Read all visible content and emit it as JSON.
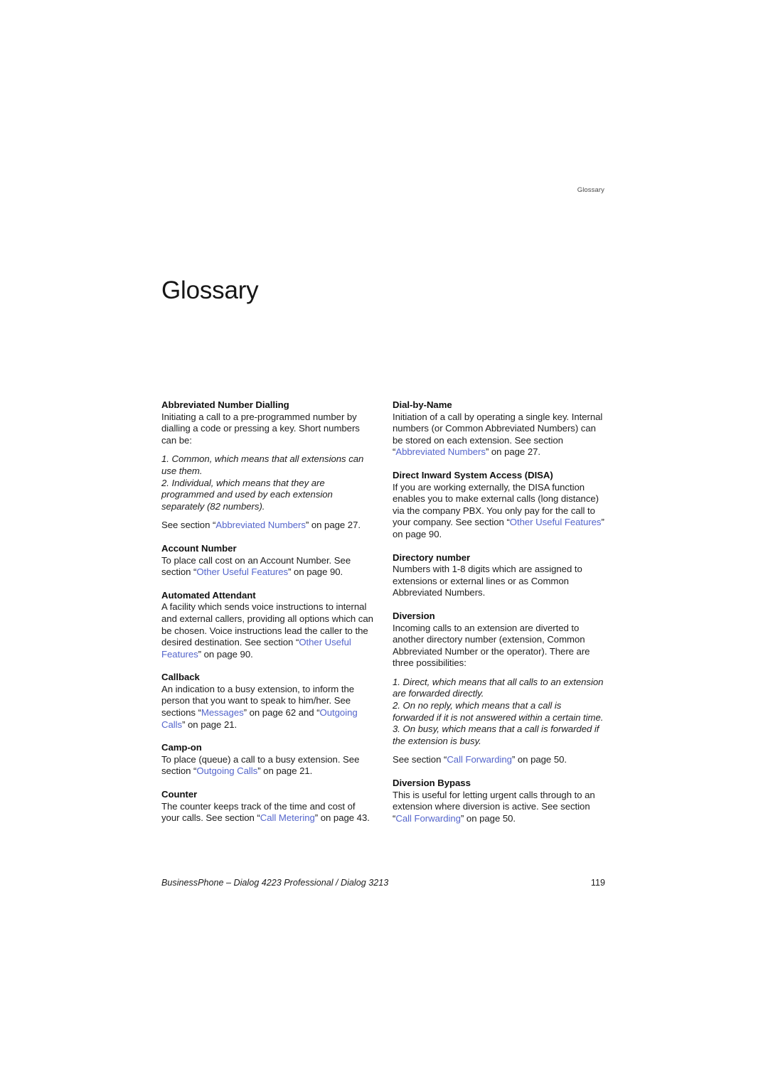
{
  "header": {
    "running_head": "Glossary"
  },
  "title": "Glossary",
  "link_color": "#5566cc",
  "left_column": {
    "entries": [
      {
        "term": "Abbreviated Number Dialling",
        "blocks": [
          {
            "style": "plain",
            "parts": [
              {
                "t": "text",
                "v": "Initiating a call to a pre-programmed number by dialling a code or pressing a key. Short numbers can be:"
              }
            ]
          },
          {
            "style": "italic-gap",
            "parts": [
              {
                "t": "text",
                "v": "1. Common, which means that all extensions can use them."
              }
            ]
          },
          {
            "style": "italic",
            "parts": [
              {
                "t": "text",
                "v": "2. Individual, which means that they are programmed and used by each extension separately (82 numbers)."
              }
            ]
          },
          {
            "style": "plain-gap",
            "parts": [
              {
                "t": "text",
                "v": "See section “"
              },
              {
                "t": "link",
                "v": "Abbreviated Numbers"
              },
              {
                "t": "text",
                "v": "” on page 27."
              }
            ]
          }
        ]
      },
      {
        "term": "Account Number",
        "blocks": [
          {
            "style": "plain",
            "parts": [
              {
                "t": "text",
                "v": "To place call cost on an Account Number. See section “"
              },
              {
                "t": "link",
                "v": "Other Useful Features"
              },
              {
                "t": "text",
                "v": "” on page 90."
              }
            ]
          }
        ]
      },
      {
        "term": "Automated Attendant",
        "blocks": [
          {
            "style": "plain",
            "parts": [
              {
                "t": "text",
                "v": "A facility which sends voice instructions to internal and external callers, providing all options which can be chosen. Voice instructions lead the caller to the desired destination. See section “"
              },
              {
                "t": "link",
                "v": "Other Useful Features"
              },
              {
                "t": "text",
                "v": "” on page 90."
              }
            ]
          }
        ]
      },
      {
        "term": "Callback",
        "blocks": [
          {
            "style": "plain",
            "parts": [
              {
                "t": "text",
                "v": "An indication to a busy extension, to inform the person that you want to speak to him/her. See sections “"
              },
              {
                "t": "link",
                "v": "Messages"
              },
              {
                "t": "text",
                "v": "” on page 62 and “"
              },
              {
                "t": "link",
                "v": "Outgoing Calls"
              },
              {
                "t": "text",
                "v": "” on page 21."
              }
            ]
          }
        ]
      },
      {
        "term": "Camp-on",
        "blocks": [
          {
            "style": "plain",
            "parts": [
              {
                "t": "text",
                "v": "To place (queue) a call to a busy extension. See section “"
              },
              {
                "t": "link",
                "v": "Outgoing Calls"
              },
              {
                "t": "text",
                "v": "” on page 21."
              }
            ]
          }
        ]
      },
      {
        "term": "Counter",
        "blocks": [
          {
            "style": "plain",
            "parts": [
              {
                "t": "text",
                "v": "The counter keeps track of the time and cost of your calls. See section “"
              },
              {
                "t": "link",
                "v": "Call Metering"
              },
              {
                "t": "text",
                "v": "” on page 43."
              }
            ]
          }
        ]
      }
    ]
  },
  "right_column": {
    "entries": [
      {
        "term": "Dial-by-Name",
        "blocks": [
          {
            "style": "plain",
            "parts": [
              {
                "t": "text",
                "v": "Initiation of a call by operating a single key. Internal numbers (or Common Abbreviated Numbers) can be stored on each extension. See section “"
              },
              {
                "t": "link",
                "v": "Abbreviated Numbers"
              },
              {
                "t": "text",
                "v": "” on page 27."
              }
            ]
          }
        ]
      },
      {
        "term": "Direct Inward System Access (DISA)",
        "blocks": [
          {
            "style": "plain",
            "parts": [
              {
                "t": "text",
                "v": "If you are working externally, the DISA function enables you to make external calls (long distance) via the company PBX. You only pay for the call to your company. See section “"
              },
              {
                "t": "link",
                "v": "Other Useful Features"
              },
              {
                "t": "text",
                "v": "” on page 90."
              }
            ]
          }
        ]
      },
      {
        "term": "Directory number",
        "blocks": [
          {
            "style": "plain",
            "parts": [
              {
                "t": "text",
                "v": "Numbers with 1-8 digits which are assigned to extensions or external lines or as Common Abbreviated Numbers."
              }
            ]
          }
        ]
      },
      {
        "term": "Diversion",
        "blocks": [
          {
            "style": "plain",
            "parts": [
              {
                "t": "text",
                "v": "Incoming calls to an extension are diverted to another directory number (extension, Common Abbreviated Number or the operator). There are three possibilities:"
              }
            ]
          },
          {
            "style": "italic-gap",
            "parts": [
              {
                "t": "text",
                "v": "1. Direct, which means that all calls to an extension are forwarded directly."
              }
            ]
          },
          {
            "style": "italic",
            "parts": [
              {
                "t": "text",
                "v": "2. On no reply, which means that a call is forwarded if it is not answered within a certain time."
              }
            ]
          },
          {
            "style": "italic",
            "parts": [
              {
                "t": "text",
                "v": "3. On busy, which means that a call is forwarded if the extension is busy."
              }
            ]
          },
          {
            "style": "plain-gap",
            "parts": [
              {
                "t": "text",
                "v": "See section “"
              },
              {
                "t": "link",
                "v": "Call Forwarding"
              },
              {
                "t": "text",
                "v": "” on page 50."
              }
            ]
          }
        ]
      },
      {
        "term": "Diversion Bypass",
        "blocks": [
          {
            "style": "plain",
            "parts": [
              {
                "t": "text",
                "v": "This is useful for letting urgent calls through to an extension where diversion is active. See section “"
              },
              {
                "t": "link",
                "v": "Call Forwarding"
              },
              {
                "t": "text",
                "v": "” on page 50."
              }
            ]
          }
        ]
      }
    ]
  },
  "footer": {
    "document_title": "BusinessPhone – Dialog 4223 Professional / Dialog 3213",
    "page_number": "119"
  }
}
